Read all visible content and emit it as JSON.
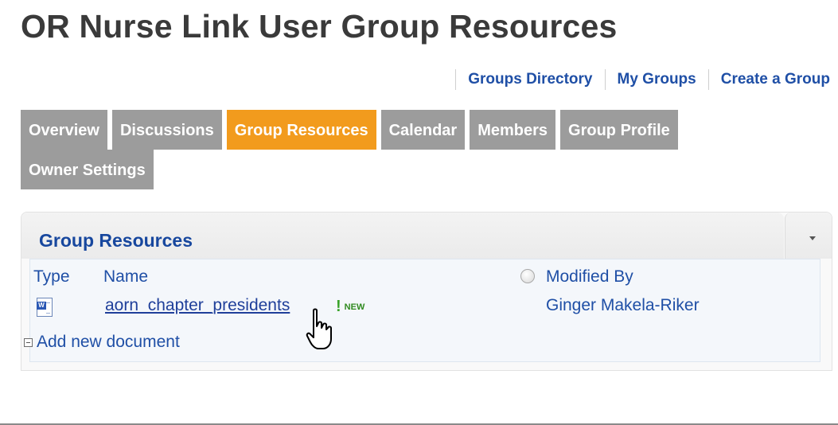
{
  "header": {
    "title": "OR Nurse Link User Group Resources"
  },
  "toplinks": {
    "groups_directory": "Groups Directory",
    "my_groups": "My Groups",
    "create_group": "Create a Group"
  },
  "tabs": [
    {
      "label": "Overview",
      "active": false
    },
    {
      "label": "Discussions",
      "active": false
    },
    {
      "label": "Group Resources",
      "active": true
    },
    {
      "label": "Calendar",
      "active": false
    },
    {
      "label": "Members",
      "active": false
    },
    {
      "label": "Group Profile",
      "active": false
    },
    {
      "label": "Owner Settings",
      "active": false
    }
  ],
  "panel": {
    "title": "Group Resources",
    "columns": {
      "type": "Type",
      "name": "Name",
      "modified_by": "Modified By"
    },
    "rows": [
      {
        "type_icon": "word-document-icon",
        "name": "aorn_chapter_presidents",
        "badge": "NEW",
        "modified_by": "Ginger Makela-Riker"
      }
    ],
    "add_new": "Add new document"
  },
  "colors": {
    "active_tab": "#f29b1d",
    "inactive_tab": "#9c9c9c",
    "link": "#1f4fa6",
    "title": "#3a3a3a"
  }
}
